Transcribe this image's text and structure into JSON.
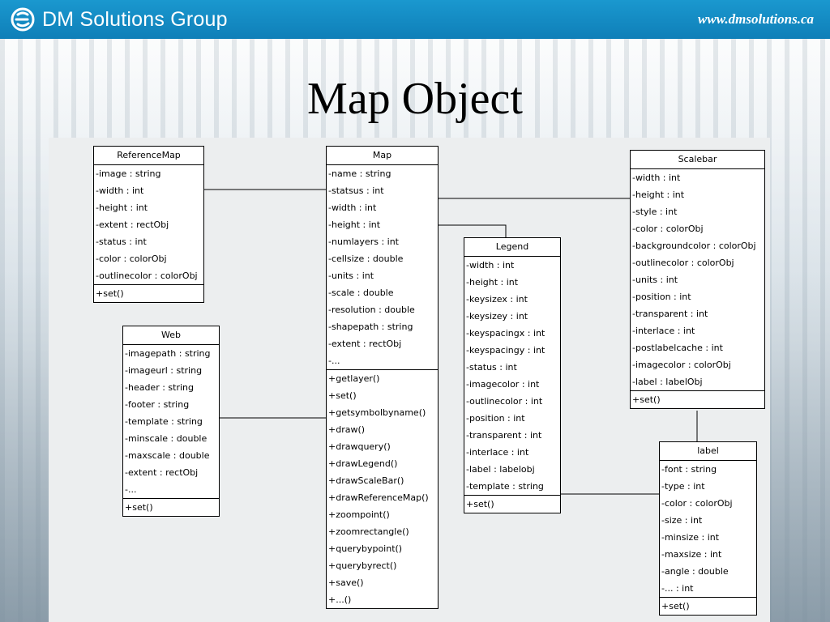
{
  "header": {
    "company": "DM Solutions Group",
    "url": "www.dmsolutions.ca"
  },
  "title": "Map Object",
  "classes": {
    "referencemap": {
      "name": "ReferenceMap",
      "attributes": [
        "-image : string",
        "-width : int",
        "-height : int",
        "-extent : rectObj",
        "-status : int",
        "-color : colorObj",
        "-outlinecolor : colorObj"
      ],
      "methods": [
        "+set()"
      ]
    },
    "web": {
      "name": "Web",
      "attributes": [
        "-imagepath : string",
        "-imageurl : string",
        "-header : string",
        "-footer : string",
        "-template : string",
        "-minscale : double",
        "-maxscale : double",
        "-extent : rectObj",
        "-..."
      ],
      "methods": [
        "+set()"
      ]
    },
    "map": {
      "name": "Map",
      "attributes": [
        "-name : string",
        "-statsus : int",
        "-width : int",
        "-height : int",
        "-numlayers : int",
        "-cellsize : double",
        "-units : int",
        "-scale : double",
        "-resolution : double",
        "-shapepath : string",
        "-extent : rectObj",
        "-..."
      ],
      "methods": [
        "+getlayer()",
        "+set()",
        "+getsymbolbyname()",
        "+draw()",
        "+drawquery()",
        "+drawLegend()",
        "+drawScaleBar()",
        "+drawReferenceMap()",
        "+zoompoint()",
        "+zoomrectangle()",
        "+querybypoint()",
        "+querybyrect()",
        "+save()",
        "+...()"
      ]
    },
    "legend": {
      "name": "Legend",
      "attributes": [
        "-width : int",
        "-height : int",
        "-keysizex : int",
        "-keysizey : int",
        "-keyspacingx : int",
        "-keyspacingy : int",
        "-status : int",
        "-imagecolor : int",
        "-outlinecolor : int",
        "-position : int",
        "-transparent : int",
        "-interlace : int",
        "-label : labelobj",
        "-template : string"
      ],
      "methods": [
        "+set()"
      ]
    },
    "scalebar": {
      "name": "Scalebar",
      "attributes": [
        "-width : int",
        "-height : int",
        "-style : int",
        "-color : colorObj",
        "-backgroundcolor : colorObj",
        "-outlinecolor : colorObj",
        "-units : int",
        "-position : int",
        "-transparent : int",
        "-interlace : int",
        "-postlabelcache : int",
        "-imagecolor : colorObj",
        "-label : labelObj"
      ],
      "methods": [
        "+set()"
      ]
    },
    "label": {
      "name": "label",
      "attributes": [
        "-font : string",
        "-type : int",
        "-color : colorObj",
        "-size : int",
        "-minsize : int",
        "-maxsize : int",
        "-angle : double",
        "-... : int"
      ],
      "methods": [
        "+set()"
      ]
    }
  },
  "colors": {
    "header_bg": "#1291c9",
    "diagram_bg": "#eceeef"
  }
}
